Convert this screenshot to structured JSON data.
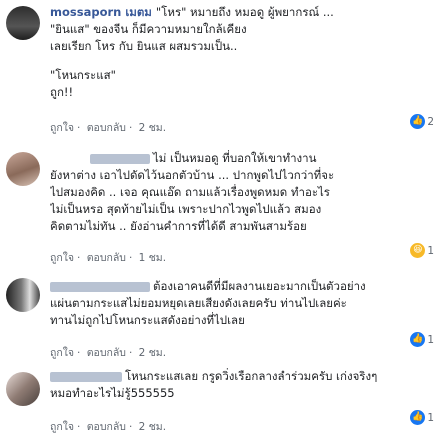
{
  "comments": [
    {
      "name": "mossaporn เมตม",
      "lines": [
        "\"โหร\" หมายถึง หมอดู ผู้พยากรณ์ ...",
        "\"ยินแส\" ของจีน ก็มีความหมายใกล้เคียง",
        "เลยเรียก โหร กับ ยินแส ผสมรวมเป็น..",
        "",
        "\"โหนกระแส\"",
        "ถูก!!"
      ],
      "like_label": "ถูกใจ",
      "reply_label": "ตอบกลับ",
      "time": "2 ชม.",
      "reaction_count": "2",
      "reaction_icon": "like-icon",
      "avatar_color": "#3a3a3a"
    },
    {
      "name": "",
      "lines": [
        "ไม่ เป็นหมอดู ที่บอกให้เขาทำงาน",
        "ยังหาต่าง เอาไปดัดไว้นอกตัวบ้าน ... ปากพูดไปไวกว่าที่จะ",
        "ไปสมองคิด .. เจอ คุณแอ๊ด ถามแล้วเรื่องพูดหมด ทำอะไร",
        "ไม่เป็นหรอ สุดท้ายไม่เป็น เพราะปากไวพูดไปแล้ว สมอง",
        "คิดตามไม่ทัน .. ยังอ่านคำการที่ได้ดี สามพันสามร้อย"
      ],
      "like_label": "ถูกใจ",
      "reply_label": "ตอบกลับ",
      "time": "1 ชม.",
      "reaction_count": "1",
      "reaction_icon": "haha-icon",
      "avatar_color": "#8a6a5a"
    },
    {
      "name": "",
      "lines": [
        "ต้องเอาคนดีที่มีผลงานเยอะมากเป็นตัวอย่าง",
        "แผ่นตามกระแสไม่ยอมหยุดเลยเสียงดังเลยครับ ท่านไปเลยค่ะ",
        "ทานไม่ถูกไปโหนกระแสดังอย่างที่ไปเลย"
      ],
      "like_label": "ถูกใจ",
      "reply_label": "ตอบกลับ",
      "time": "2 ชม.",
      "reaction_count": "1",
      "reaction_icon": "like-icon",
      "avatar_color": "#555555"
    },
    {
      "name": "",
      "lines": [
        "โหนกระแสเลย กรูดวิ่งเรือกลางลำร่วมครับ เก่งจริงๆ",
        "หมอทำอะไรไม่รู้555555"
      ],
      "like_label": "ถูกใจ",
      "reply_label": "ตอบกลับ",
      "time": "2 ชม.",
      "reaction_count": "1",
      "reaction_icon": "like-icon",
      "avatar_color": "#6d5d56"
    }
  ]
}
